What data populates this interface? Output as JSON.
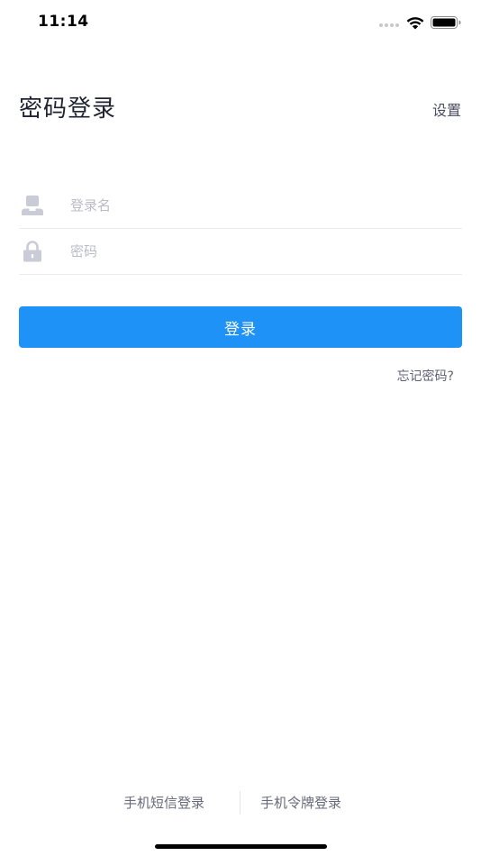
{
  "status_bar": {
    "time": "11:14"
  },
  "header": {
    "title": "密码登录",
    "settings_label": "设置"
  },
  "form": {
    "username": {
      "placeholder": "登录名",
      "value": "",
      "icon": "user-icon"
    },
    "password": {
      "placeholder": "密码",
      "value": "",
      "icon": "lock-icon"
    },
    "login_label": "登录",
    "forgot_label": "忘记密码?"
  },
  "alternatives": {
    "sms_label": "手机短信登录",
    "token_label": "手机令牌登录"
  },
  "colors": {
    "primary": "#1f92f7",
    "title_text": "#1f2230",
    "placeholder": "#b9bcc6",
    "icon": "#c9ccd6"
  }
}
